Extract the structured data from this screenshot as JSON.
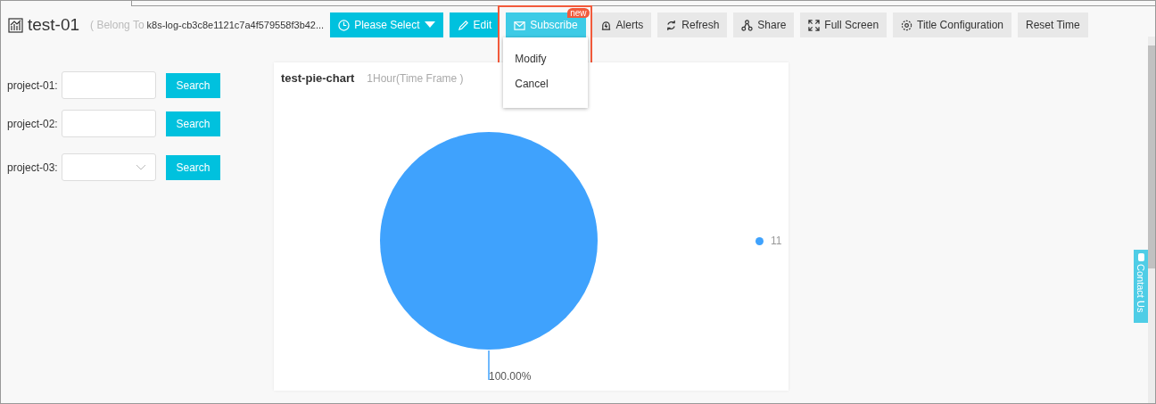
{
  "header": {
    "title": "test-01",
    "belong_to": "( Belong To ",
    "belong_value": "k8s-log-cb3c8e1121c7a4f579558f3b42..."
  },
  "toolbar": [
    {
      "label": "Please Select",
      "kind": "primary",
      "caret": true
    },
    {
      "label": "Edit",
      "kind": "primary"
    },
    {
      "label": "Subscribe",
      "kind": "primary",
      "badge": "new",
      "open": true,
      "menu": [
        "Modify",
        "Cancel"
      ]
    },
    {
      "label": "Alerts",
      "kind": "default"
    },
    {
      "label": "Refresh",
      "kind": "default"
    },
    {
      "label": "Share",
      "kind": "default"
    },
    {
      "label": "Full Screen",
      "kind": "default"
    },
    {
      "label": "Title Configuration",
      "kind": "default"
    },
    {
      "label": "Reset Time",
      "kind": "default"
    }
  ],
  "filters": [
    {
      "label": "project-01:",
      "kind": "text",
      "button": "Search"
    },
    {
      "label": "project-02:",
      "kind": "text",
      "button": "Search"
    },
    {
      "label": "project-03:",
      "kind": "select",
      "button": "Search"
    }
  ],
  "chart_card": {
    "title": "test-pie-chart",
    "time_frame": "1Hour(Time Frame )",
    "chart_data": {
      "type": "pie",
      "series": [
        {
          "name": "11",
          "color": "#3fa2fd",
          "values": [
            100
          ]
        }
      ],
      "value_labels": [
        "100.00%"
      ]
    }
  },
  "contact_tab": "Contact Us"
}
